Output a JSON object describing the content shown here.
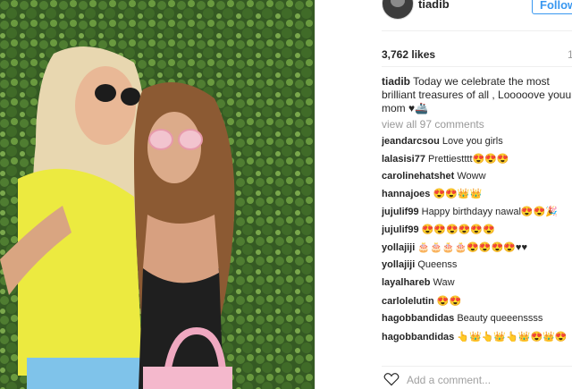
{
  "post": {
    "username": "tiadib",
    "follow_label": "Follow",
    "likes": "3,762 likes",
    "time_fragment": "1",
    "caption_user": "tiadib",
    "caption_text": "Today we celebrate the most brilliant treasures of all , Looooove youu mom ♥🚢",
    "view_all": "view all 97 comments",
    "add_comment_placeholder": "Add a comment..."
  },
  "comments": [
    {
      "user": "jeandarcsou",
      "text": "Love you girls"
    },
    {
      "user": "lalasisi77",
      "text": "Prettiestttt😍😍😍"
    },
    {
      "user": "carolinehatshet",
      "text": "Woww"
    },
    {
      "user": "hannajoes",
      "text": "😍😍👑👑"
    },
    {
      "user": "jujulif99",
      "text": "Happy birthdayy nawal😍😍🎉"
    },
    {
      "user": "jujulif99",
      "text": "😍😍😍😍😍😍"
    },
    {
      "user": "yollajiji",
      "text": "🎂🎂🎂🎂😍😍😍😍♥♥"
    },
    {
      "user": "yollajiji",
      "text": "Queenss"
    },
    {
      "user": "layalhareb",
      "text": "Waw"
    },
    {
      "user": "carlolelutin",
      "text": "😍😍"
    },
    {
      "user": "hagobbandidas",
      "text": "Beauty queeenssss"
    },
    {
      "user": "hagobbandidas",
      "text": "👆👑👆👑👆👑😍👑😍"
    }
  ],
  "icons": {
    "avatar": "profile-avatar",
    "heart": "heart-outline-icon"
  },
  "colors": {
    "follow_blue": "#3897f0",
    "text": "#262626",
    "muted": "#999999"
  }
}
